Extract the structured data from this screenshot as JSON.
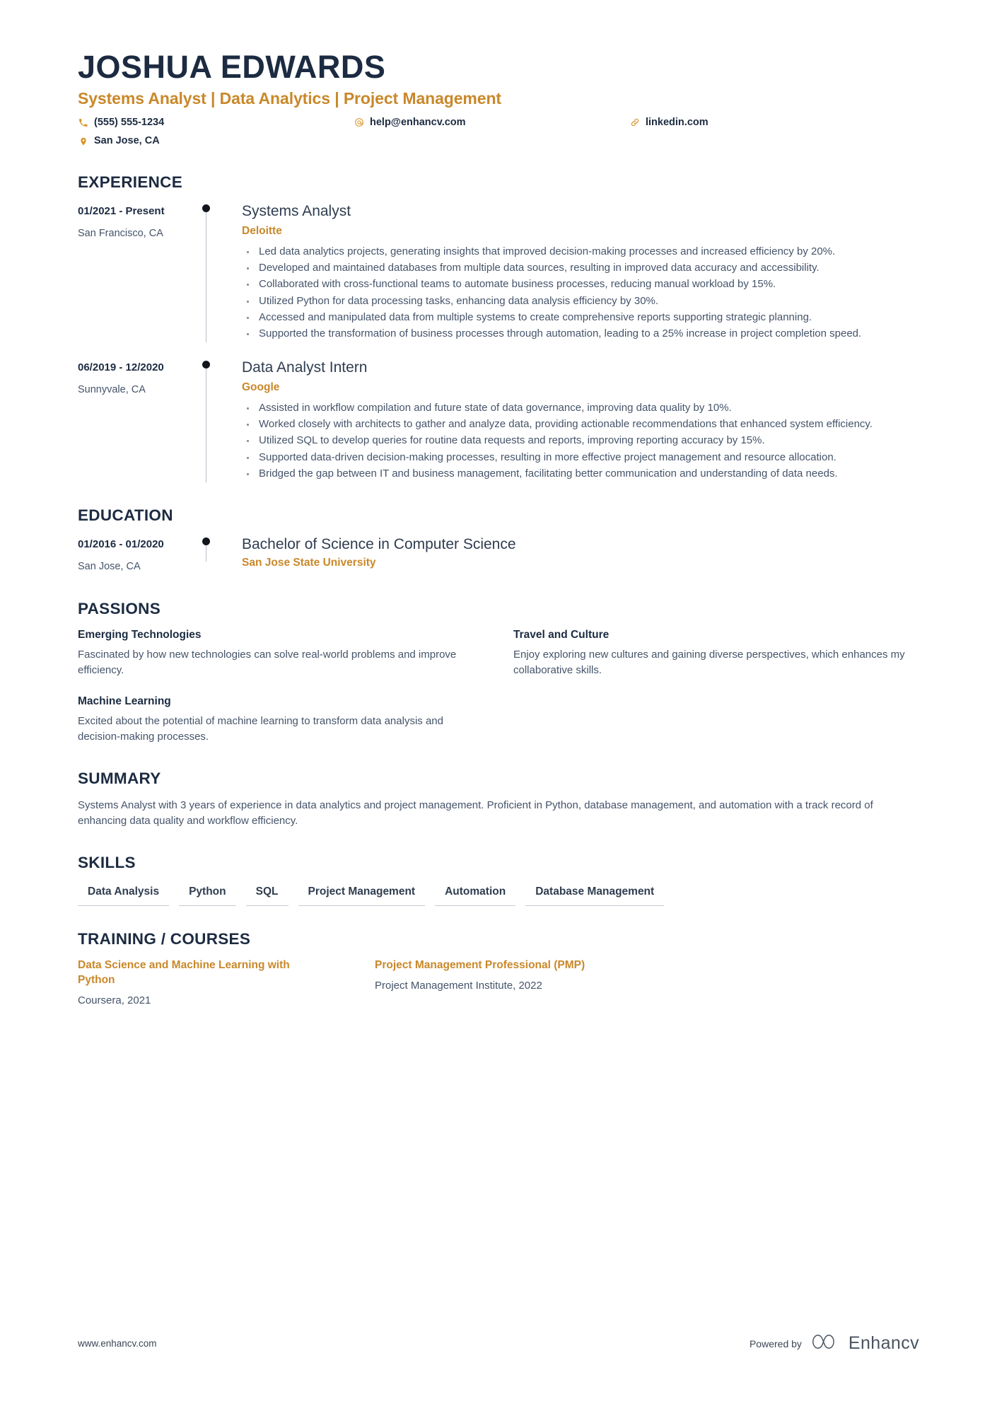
{
  "header": {
    "name": "JOSHUA EDWARDS",
    "headline": "Systems Analyst | Data Analytics | Project Management",
    "contacts": [
      {
        "icon": "phone-icon",
        "text": "(555) 555-1234"
      },
      {
        "icon": "email-icon",
        "text": "help@enhancv.com"
      },
      {
        "icon": "link-icon",
        "text": "linkedin.com"
      },
      {
        "icon": "location-icon",
        "text": "San Jose, CA"
      }
    ]
  },
  "sections": {
    "experience_title": "EXPERIENCE",
    "education_title": "EDUCATION",
    "passions_title": "PASSIONS",
    "summary_title": "SUMMARY",
    "skills_title": "SKILLS",
    "training_title": "TRAINING / COURSES"
  },
  "experience": [
    {
      "date": "01/2021 - Present",
      "location": "San Francisco, CA",
      "role": "Systems Analyst",
      "company": "Deloitte",
      "bullets": [
        "Led data analytics projects, generating insights that improved decision-making processes and increased efficiency by 20%.",
        "Developed and maintained databases from multiple data sources, resulting in improved data accuracy and accessibility.",
        "Collaborated with cross-functional teams to automate business processes, reducing manual workload by 15%.",
        "Utilized Python for data processing tasks, enhancing data analysis efficiency by 30%.",
        "Accessed and manipulated data from multiple systems to create comprehensive reports supporting strategic planning.",
        "Supported the transformation of business processes through automation, leading to a 25% increase in project completion speed."
      ]
    },
    {
      "date": "06/2019 - 12/2020",
      "location": "Sunnyvale, CA",
      "role": "Data Analyst Intern",
      "company": "Google",
      "bullets": [
        "Assisted in workflow compilation and future state of data governance, improving data quality by 10%.",
        "Worked closely with architects to gather and analyze data, providing actionable recommendations that enhanced system efficiency.",
        "Utilized SQL to develop queries for routine data requests and reports, improving reporting accuracy by 15%.",
        "Supported data-driven decision-making processes, resulting in more effective project management and resource allocation.",
        "Bridged the gap between IT and business management, facilitating better communication and understanding of data needs."
      ]
    }
  ],
  "education": [
    {
      "date": "01/2016 - 01/2020",
      "location": "San Jose, CA",
      "degree": "Bachelor of Science in Computer Science",
      "school": "San Jose State University"
    }
  ],
  "passions": [
    {
      "title": "Emerging Technologies",
      "text": "Fascinated by how new technologies can solve real-world problems and improve efficiency."
    },
    {
      "title": "Travel and Culture",
      "text": "Enjoy exploring new cultures and gaining diverse perspectives, which enhances my collaborative skills."
    },
    {
      "title": "Machine Learning",
      "text": "Excited about the potential of machine learning to transform data analysis and decision-making processes."
    }
  ],
  "summary": {
    "text": "Systems Analyst with 3 years of experience in data analytics and project management. Proficient in Python, database management, and automation with a track record of enhancing data quality and workflow efficiency."
  },
  "skills": [
    "Data Analysis",
    "Python",
    "SQL",
    "Project Management",
    "Automation",
    "Database Management"
  ],
  "training": [
    {
      "name": "Data Science and Machine Learning with Python",
      "meta": "Coursera, 2021"
    },
    {
      "name": "Project Management Professional (PMP)",
      "meta": "Project Management Institute, 2022"
    }
  ],
  "footer": {
    "url": "www.enhancv.com",
    "powered_by": "Powered by",
    "brand": "Enhancv"
  },
  "colors": {
    "accent": "#c9882a",
    "dark": "#1c2b41",
    "body": "#45546a"
  }
}
